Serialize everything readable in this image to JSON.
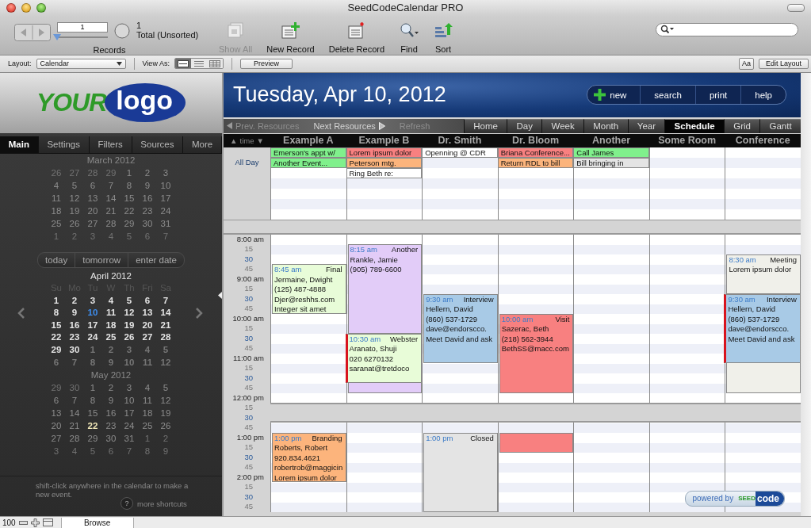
{
  "window": {
    "title": "SeedCodeCalendar PRO"
  },
  "toolbar": {
    "record_field": "1",
    "record_slider": {
      "level": 0
    },
    "record_count": "1",
    "record_total": "Total (Unsorted)",
    "records_label": "Records",
    "buttons": [
      {
        "label": "Show All",
        "kind": "show-all",
        "disabled": true
      },
      {
        "label": "New Record",
        "kind": "new-record",
        "disabled": false
      },
      {
        "label": "Delete Record",
        "kind": "delete-record",
        "disabled": false
      },
      {
        "label": "Find",
        "kind": "find",
        "disabled": false
      },
      {
        "label": "Sort",
        "kind": "sort",
        "disabled": false
      }
    ]
  },
  "layout_bar": {
    "layout_label": "Layout:",
    "layout_value": "Calendar",
    "view_as_label": "View As:",
    "view_modes": [
      {
        "kind": "form",
        "selected": true
      },
      {
        "kind": "list",
        "selected": false
      },
      {
        "kind": "table",
        "selected": false
      }
    ],
    "preview": "Preview",
    "format_button": "Aa",
    "edit_layout": "Edit Layout"
  },
  "sidebar": {
    "logo": {
      "first": "YOUR",
      "second": "logo"
    },
    "tabs": [
      {
        "label": "Main",
        "selected": true
      },
      {
        "label": "Settings",
        "selected": false
      },
      {
        "label": "Filters",
        "selected": false
      },
      {
        "label": "Sources",
        "selected": false
      },
      {
        "label": "More",
        "selected": false
      }
    ],
    "months": [
      {
        "title": "March 2012",
        "active": false,
        "weeks": [
          [
            {
              "d": "26",
              "kind": "out"
            },
            {
              "d": "27",
              "kind": "out"
            },
            {
              "d": "28",
              "kind": "out"
            },
            {
              "d": "29",
              "kind": "out"
            },
            {
              "d": "1",
              "kind": "in"
            },
            {
              "d": "2",
              "kind": "in"
            },
            {
              "d": "3",
              "kind": "in"
            }
          ],
          [
            {
              "d": "4",
              "kind": "in"
            },
            {
              "d": "5",
              "kind": "in"
            },
            {
              "d": "6",
              "kind": "in"
            },
            {
              "d": "7",
              "kind": "in"
            },
            {
              "d": "8",
              "kind": "in"
            },
            {
              "d": "9",
              "kind": "in"
            },
            {
              "d": "10",
              "kind": "in"
            }
          ],
          [
            {
              "d": "11",
              "kind": "in"
            },
            {
              "d": "12",
              "kind": "in"
            },
            {
              "d": "13",
              "kind": "in"
            },
            {
              "d": "14",
              "kind": "in"
            },
            {
              "d": "15",
              "kind": "in"
            },
            {
              "d": "16",
              "kind": "in"
            },
            {
              "d": "17",
              "kind": "in"
            }
          ],
          [
            {
              "d": "18",
              "kind": "in"
            },
            {
              "d": "19",
              "kind": "in"
            },
            {
              "d": "20",
              "kind": "in"
            },
            {
              "d": "21",
              "kind": "in"
            },
            {
              "d": "22",
              "kind": "in"
            },
            {
              "d": "23",
              "kind": "in"
            },
            {
              "d": "24",
              "kind": "in"
            }
          ],
          [
            {
              "d": "25",
              "kind": "in"
            },
            {
              "d": "26",
              "kind": "in"
            },
            {
              "d": "27",
              "kind": "in"
            },
            {
              "d": "28",
              "kind": "in"
            },
            {
              "d": "29",
              "kind": "in"
            },
            {
              "d": "30",
              "kind": "in"
            },
            {
              "d": "31",
              "kind": "in"
            }
          ],
          [
            {
              "d": "1",
              "kind": "out"
            },
            {
              "d": "2",
              "kind": "out"
            },
            {
              "d": "3",
              "kind": "out"
            },
            {
              "d": "4",
              "kind": "out"
            },
            {
              "d": "5",
              "kind": "out"
            },
            {
              "d": "6",
              "kind": "out"
            },
            {
              "d": "7",
              "kind": "out"
            }
          ]
        ]
      },
      {
        "title": "April 2012",
        "active": true,
        "weekdays": [
          "Su",
          "Mo",
          "Tu",
          "W",
          "Th",
          "Fri",
          "Sa"
        ],
        "weeks": [
          [
            {
              "d": "1",
              "kind": "in"
            },
            {
              "d": "2",
              "kind": "in"
            },
            {
              "d": "3",
              "kind": "in"
            },
            {
              "d": "4",
              "kind": "in"
            },
            {
              "d": "5",
              "kind": "in"
            },
            {
              "d": "6",
              "kind": "in"
            },
            {
              "d": "7",
              "kind": "in"
            }
          ],
          [
            {
              "d": "8",
              "kind": "in"
            },
            {
              "d": "9",
              "kind": "in"
            },
            {
              "d": "10",
              "kind": "today"
            },
            {
              "d": "11",
              "kind": "in"
            },
            {
              "d": "12",
              "kind": "in"
            },
            {
              "d": "13",
              "kind": "in"
            },
            {
              "d": "14",
              "kind": "in"
            }
          ],
          [
            {
              "d": "15",
              "kind": "in"
            },
            {
              "d": "16",
              "kind": "in"
            },
            {
              "d": "17",
              "kind": "in"
            },
            {
              "d": "18",
              "kind": "in"
            },
            {
              "d": "19",
              "kind": "in"
            },
            {
              "d": "20",
              "kind": "in"
            },
            {
              "d": "21",
              "kind": "in"
            }
          ],
          [
            {
              "d": "22",
              "kind": "in"
            },
            {
              "d": "23",
              "kind": "in"
            },
            {
              "d": "24",
              "kind": "in"
            },
            {
              "d": "25",
              "kind": "in"
            },
            {
              "d": "26",
              "kind": "in"
            },
            {
              "d": "27",
              "kind": "in"
            },
            {
              "d": "28",
              "kind": "in"
            }
          ],
          [
            {
              "d": "29",
              "kind": "in"
            },
            {
              "d": "30",
              "kind": "in"
            },
            {
              "d": "1",
              "kind": "out"
            },
            {
              "d": "2",
              "kind": "out"
            },
            {
              "d": "3",
              "kind": "out"
            },
            {
              "d": "4",
              "kind": "out"
            },
            {
              "d": "5",
              "kind": "out"
            }
          ],
          [
            {
              "d": "6",
              "kind": "out"
            },
            {
              "d": "7",
              "kind": "out"
            },
            {
              "d": "8",
              "kind": "out"
            },
            {
              "d": "9",
              "kind": "out"
            },
            {
              "d": "10",
              "kind": "out"
            },
            {
              "d": "11",
              "kind": "out"
            },
            {
              "d": "12",
              "kind": "out"
            }
          ]
        ]
      },
      {
        "title": "May 2012",
        "active": false,
        "weeks": [
          [
            {
              "d": "29",
              "kind": "out"
            },
            {
              "d": "30",
              "kind": "out"
            },
            {
              "d": "1",
              "kind": "in"
            },
            {
              "d": "2",
              "kind": "in"
            },
            {
              "d": "3",
              "kind": "in"
            },
            {
              "d": "4",
              "kind": "in"
            },
            {
              "d": "5",
              "kind": "in"
            }
          ],
          [
            {
              "d": "6",
              "kind": "in"
            },
            {
              "d": "7",
              "kind": "in"
            },
            {
              "d": "8",
              "kind": "in"
            },
            {
              "d": "9",
              "kind": "in"
            },
            {
              "d": "10",
              "kind": "in"
            },
            {
              "d": "11",
              "kind": "in"
            },
            {
              "d": "12",
              "kind": "in"
            }
          ],
          [
            {
              "d": "13",
              "kind": "in"
            },
            {
              "d": "14",
              "kind": "in"
            },
            {
              "d": "15",
              "kind": "in"
            },
            {
              "d": "16",
              "kind": "in"
            },
            {
              "d": "17",
              "kind": "in"
            },
            {
              "d": "18",
              "kind": "in"
            },
            {
              "d": "19",
              "kind": "in"
            }
          ],
          [
            {
              "d": "20",
              "kind": "in"
            },
            {
              "d": "21",
              "kind": "in"
            },
            {
              "d": "22",
              "kind": "marked"
            },
            {
              "d": "23",
              "kind": "in"
            },
            {
              "d": "24",
              "kind": "in"
            },
            {
              "d": "25",
              "kind": "in"
            },
            {
              "d": "26",
              "kind": "in"
            }
          ],
          [
            {
              "d": "27",
              "kind": "in"
            },
            {
              "d": "28",
              "kind": "in"
            },
            {
              "d": "29",
              "kind": "in"
            },
            {
              "d": "30",
              "kind": "in"
            },
            {
              "d": "31",
              "kind": "in"
            },
            {
              "d": "1",
              "kind": "out"
            },
            {
              "d": "2",
              "kind": "out"
            }
          ],
          [
            {
              "d": "3",
              "kind": "out"
            },
            {
              "d": "4",
              "kind": "out"
            },
            {
              "d": "5",
              "kind": "out"
            },
            {
              "d": "6",
              "kind": "out"
            },
            {
              "d": "7",
              "kind": "out"
            },
            {
              "d": "8",
              "kind": "out"
            },
            {
              "d": "9",
              "kind": "out"
            }
          ]
        ]
      }
    ],
    "quick_buttons": [
      "today",
      "tomorrow",
      "enter date"
    ],
    "hint": "shift-click anywhere in the calendar to make a new event.",
    "shortcuts_icon": "?",
    "shortcuts_label": "more shortcuts"
  },
  "calendar": {
    "date_title": "Tuesday, Apr 10, 2012",
    "actions": [
      {
        "label": "new",
        "kind": "new"
      },
      {
        "label": "search",
        "kind": "plain"
      },
      {
        "label": "print",
        "kind": "plain"
      },
      {
        "label": "help",
        "kind": "plain"
      }
    ],
    "resource_nav": [
      {
        "label": "Prev. Resources",
        "kind": "prev",
        "disabled": true
      },
      {
        "label": "Next Resources",
        "kind": "next",
        "disabled": false
      },
      {
        "label": "Refresh",
        "kind": "plain",
        "disabled": true
      }
    ],
    "view_tabs": [
      {
        "label": "Home",
        "selected": false
      },
      {
        "label": "Day",
        "selected": false
      },
      {
        "label": "Week",
        "selected": false
      },
      {
        "label": "Month",
        "selected": false
      },
      {
        "label": "Year",
        "selected": false
      },
      {
        "label": "Schedule",
        "selected": true
      },
      {
        "label": "Grid",
        "selected": false
      },
      {
        "label": "Gantt",
        "selected": false
      }
    ],
    "time_header": {
      "up": "▲",
      "label": "time",
      "down": "▼"
    },
    "all_day_label": "All Day",
    "time_labels": [
      {
        "label": "8:00 am",
        "kind": "hour"
      },
      {
        "label": "15",
        "kind": "quarter"
      },
      {
        "label": "30",
        "kind": "half"
      },
      {
        "label": "45",
        "kind": "quarter"
      },
      {
        "label": "9:00 am",
        "kind": "hour"
      },
      {
        "label": "15",
        "kind": "quarter"
      },
      {
        "label": "30",
        "kind": "half"
      },
      {
        "label": "45",
        "kind": "quarter"
      },
      {
        "label": "10:00 am",
        "kind": "hour"
      },
      {
        "label": "15",
        "kind": "quarter"
      },
      {
        "label": "30",
        "kind": "half"
      },
      {
        "label": "45",
        "kind": "quarter"
      },
      {
        "label": "11:00 am",
        "kind": "hour"
      },
      {
        "label": "15",
        "kind": "quarter"
      },
      {
        "label": "30",
        "kind": "half"
      },
      {
        "label": "45",
        "kind": "quarter"
      },
      {
        "label": "12:00 pm",
        "kind": "hour"
      },
      {
        "label": "15",
        "kind": "quarter"
      },
      {
        "label": "30",
        "kind": "half"
      },
      {
        "label": "45",
        "kind": "quarter"
      },
      {
        "label": "1:00 pm",
        "kind": "hour"
      },
      {
        "label": "15",
        "kind": "quarter"
      },
      {
        "label": "30",
        "kind": "half"
      },
      {
        "label": "45",
        "kind": "quarter"
      },
      {
        "label": "2:00 pm",
        "kind": "hour"
      },
      {
        "label": "15",
        "kind": "quarter"
      },
      {
        "label": "30",
        "kind": "half"
      },
      {
        "label": "45",
        "kind": "quarter"
      }
    ],
    "resources": [
      {
        "name": "Example A",
        "all_day": [
          {
            "title": "Emerson's appt w/",
            "color": "#80f08c"
          },
          {
            "title": "Another Event...",
            "color": "#80f08c"
          }
        ],
        "events": [
          {
            "time": "8:45 am",
            "title": "Final",
            "lines": [
              "Jermaine, Dwight",
              "(125) 487-4888",
              "Djer@reshhs.com",
              "Integer sit amet"
            ],
            "color": "#e8fcd8",
            "conflict": false
          },
          {
            "time": "1:00 pm",
            "title": "Branding",
            "lines": [
              "Roberts, Robert",
              "920.834.4621",
              "robertrob@maggicin",
              "Lorem ipsum dolor"
            ],
            "color": "#fcb47c",
            "conflict": false
          }
        ]
      },
      {
        "name": "Example B",
        "all_day": [
          {
            "title": "Lorem ipsum dolor",
            "color": "#f88080"
          },
          {
            "title": "Peterson mtg.",
            "color": "#fcb47c"
          },
          {
            "title": "Ring Beth re:",
            "color": "#ffffff"
          }
        ],
        "events": [
          {
            "time": "8:15 am",
            "title": "Another",
            "lines": [
              "Rankle, Jamie",
              "(905) 789-6600"
            ],
            "color": "#e2ccf8",
            "conflict": false
          },
          {
            "time": "10:30 am",
            "title": "Webster",
            "lines": [
              "Aranato, Shuji",
              "020 6270132",
              "saranat@tretdoco"
            ],
            "color": "#e8fcd8",
            "conflict": true
          }
        ]
      },
      {
        "name": "Dr. Smith",
        "all_day": [
          {
            "title": "Openning @ CDR",
            "color": "#ffffff"
          }
        ],
        "events": [
          {
            "time": "9:30 am",
            "title": "Interview",
            "lines": [
              "Hellern, David",
              "(860) 537-1729",
              "dave@endorscco.",
              "Meet David and ask"
            ],
            "color": "#a8cae6",
            "conflict": false
          },
          {
            "time": "1:00 pm",
            "title": "Closed",
            "color": "#e4e4e4",
            "conflict": false
          }
        ]
      },
      {
        "name": "Dr. Bloom",
        "all_day": [
          {
            "title": "Briana Conference...",
            "color": "#f88080"
          },
          {
            "title": "Return RDL to bill",
            "color": "#fcb47c"
          }
        ],
        "events": [
          {
            "time": "10:00 am",
            "title": "Visit",
            "lines": [
              "Sazerac, Beth",
              "(218) 562-3944",
              "BethSS@macc.com"
            ],
            "color": "#f88080",
            "conflict": false
          },
          {
            "color": "#f88080",
            "conflict": false
          }
        ]
      },
      {
        "name": "Another",
        "all_day": [
          {
            "title": "Call James",
            "color": "#80f08c"
          },
          {
            "title": "Bill bringing in",
            "color": "#e4e4e4"
          }
        ]
      },
      {
        "name": "Some Room"
      },
      {
        "name": "Conference",
        "events": [
          {
            "time": "8:30 am",
            "title": "Meeting",
            "lines": [
              "Lorem ipsum dolor"
            ],
            "color": "#f0f0ea",
            "conflict": false
          },
          {
            "time": "9:30 am",
            "title": "Interview",
            "lines": [
              "Hellern, David",
              "(860) 537-1729",
              "dave@endorscco.",
              "Meet David and ask"
            ],
            "color": "#a8cae6",
            "conflict": true
          }
        ]
      }
    ],
    "powered_by": {
      "text": "powered by",
      "brand_first": "SEED",
      "brand_second": "code"
    }
  },
  "status_bar": {
    "zoom": "100",
    "mode": "Browse"
  }
}
